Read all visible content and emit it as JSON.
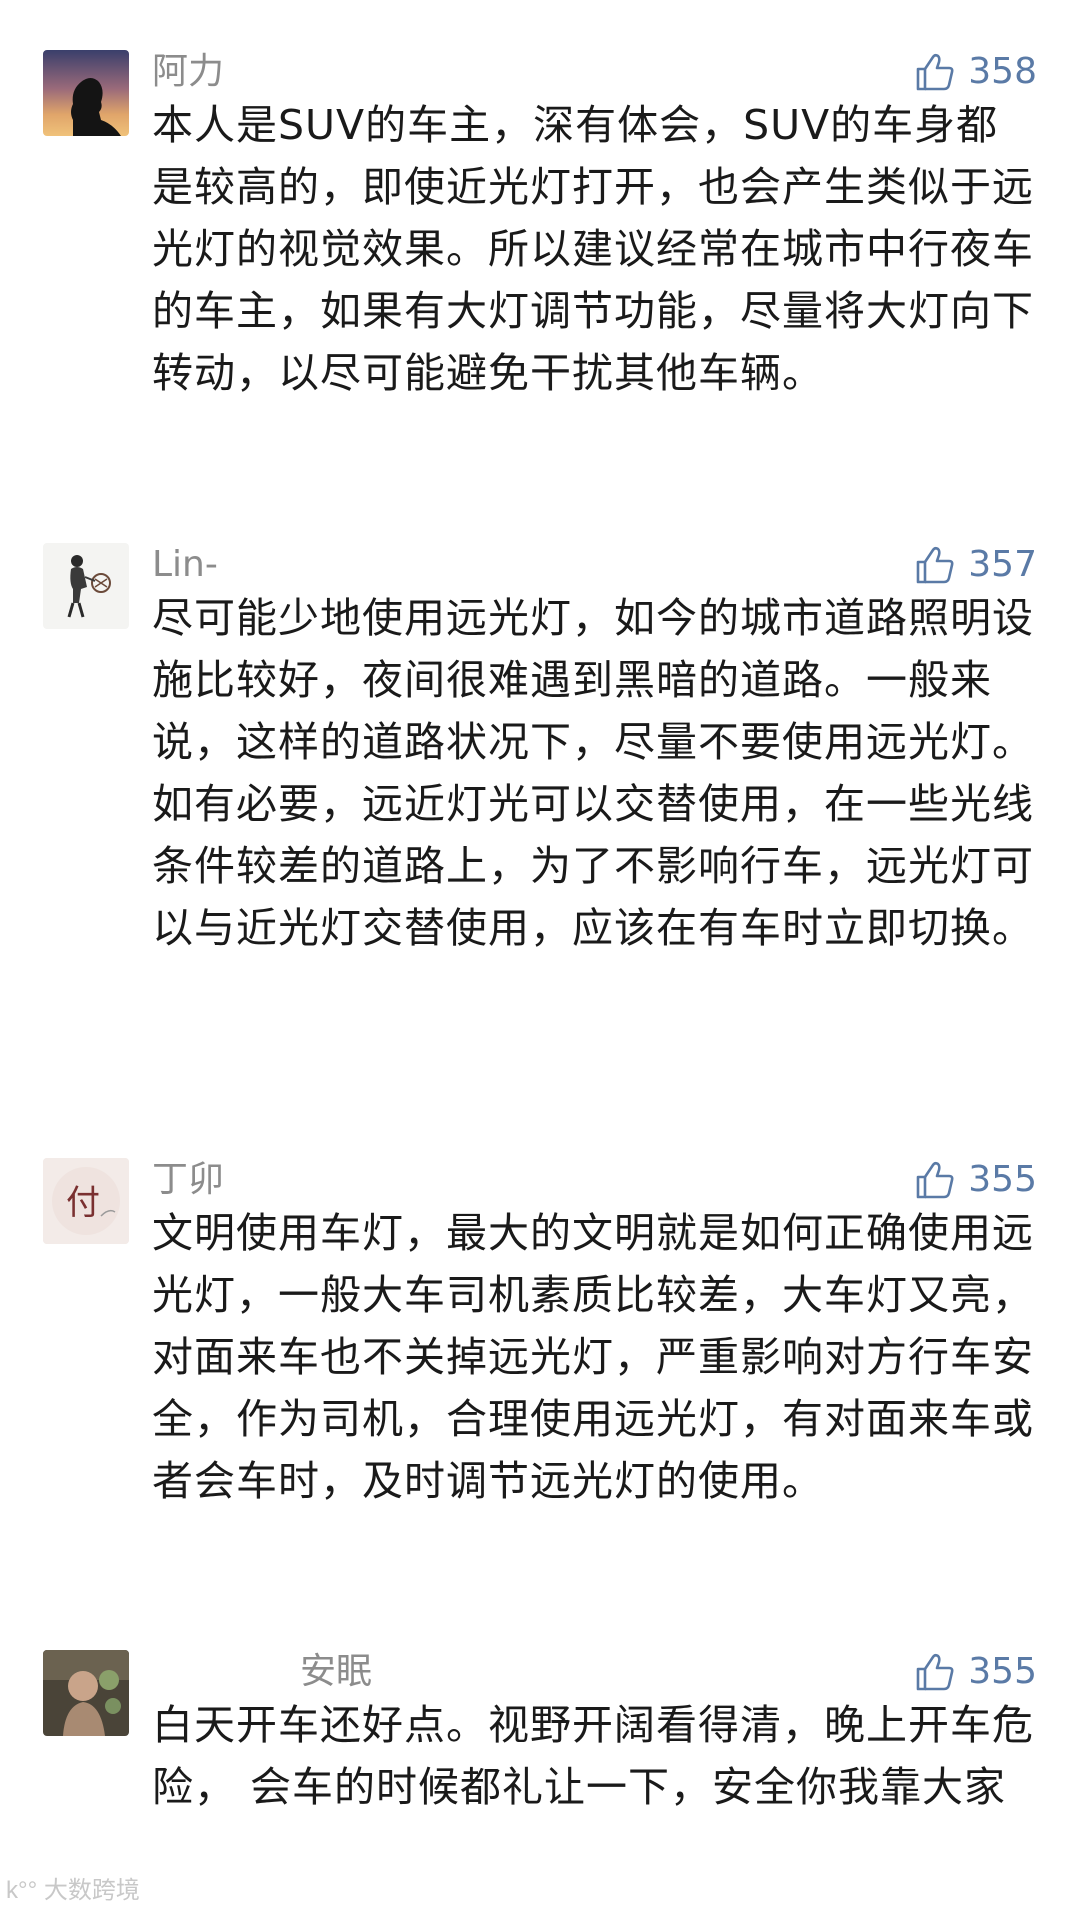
{
  "comments": [
    {
      "username": "阿力",
      "likes": "358",
      "paragraphs": [
        "本人是SUV的车主，深有体会，SUV的车身都是较高的，即使近光灯打开，也会产生类似于远光灯的视觉效果。所以建议经常在城市中行夜车的车主，如果有大灯调节功能，尽量将大灯向下转动，以尽可能避免干扰其他车辆。"
      ]
    },
    {
      "username": "Lin-",
      "likes": "357",
      "paragraphs": [
        "尽可能少地使用远光灯，如今的城市道路照明设施比较好，夜间很难遇到黑暗的道路。一般来说，这样的道路状况下，尽量不要使用远光灯。",
        "如有必要，远近灯光可以交替使用，在一些光线条件较差的道路上，为了不影响行车，远光灯可以与近光灯交替使用，应该在有车时立即切换。"
      ]
    },
    {
      "username": "丁卯",
      "likes": "355",
      "paragraphs": [
        "文明使用车灯，最大的文明就是如何正确使用远光灯，一般大车司机素质比较差，大车灯又亮，对面来车也不关掉远光灯，严重影响对方行车安全，作为司机，合理使用远光灯，有对面来车或者会车时，及时调节远光灯的使用。"
      ]
    },
    {
      "username": "安眠",
      "likes": "355",
      "paragraphs": [
        "白天开车还好点。视野开阔看得清，晚上开车危险， 会车的时候都礼让一下，安全你我靠大家"
      ]
    }
  ],
  "avatar_glyph_3": "付",
  "icons": {
    "like": "thumbs-up-icon"
  },
  "colors": {
    "like_count": "#5a7aa6",
    "username": "#8c8c8c",
    "body_text": "#1a1a1a"
  },
  "watermark": "大数跨境"
}
